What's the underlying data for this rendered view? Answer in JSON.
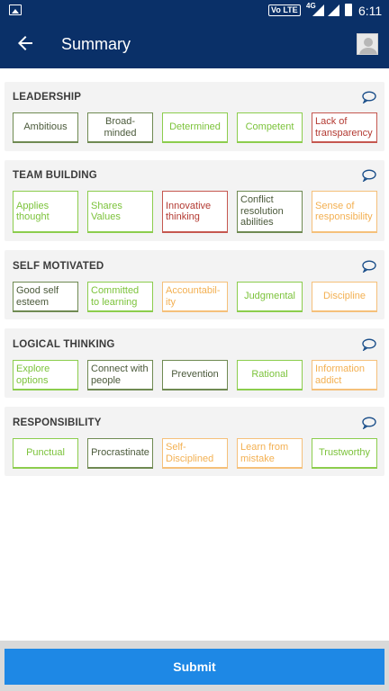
{
  "status_bar": {
    "network_badge": "Vo LTE",
    "network_type": "4G",
    "time": "6:11"
  },
  "header": {
    "title": "Summary"
  },
  "sections": [
    {
      "title": "LEADERSHIP",
      "chips": [
        {
          "label": "Ambitious",
          "color": "dark"
        },
        {
          "label": "Broad-minded",
          "color": "dark"
        },
        {
          "label": "Determined",
          "color": "lime"
        },
        {
          "label": "Competent",
          "color": "lime"
        },
        {
          "label": "Lack of transparency",
          "color": "red"
        }
      ]
    },
    {
      "title": "TEAM BUILDING",
      "chips": [
        {
          "label": "Applies thought",
          "color": "lime"
        },
        {
          "label": "Shares Values",
          "color": "lime"
        },
        {
          "label": "Innovative thinking",
          "color": "red"
        },
        {
          "label": "Conflict resolution abilities",
          "color": "dark"
        },
        {
          "label": "Sense of responsibility",
          "color": "orange"
        }
      ]
    },
    {
      "title": "SELF MOTIVATED",
      "chips": [
        {
          "label": "Good self esteem",
          "color": "dark"
        },
        {
          "label": "Committed to learning",
          "color": "lime"
        },
        {
          "label": "Accountabil-ity",
          "color": "orange"
        },
        {
          "label": "Judgmental",
          "color": "lime"
        },
        {
          "label": "Discipline",
          "color": "orange"
        }
      ]
    },
    {
      "title": "LOGICAL THINKING",
      "chips": [
        {
          "label": "Explore options",
          "color": "lime"
        },
        {
          "label": "Connect with people",
          "color": "dark"
        },
        {
          "label": "Prevention",
          "color": "dark"
        },
        {
          "label": "Rational",
          "color": "lime"
        },
        {
          "label": "Information addict",
          "color": "orange"
        }
      ]
    },
    {
      "title": "RESPONSIBILITY",
      "chips": [
        {
          "label": "Punctual",
          "color": "lime"
        },
        {
          "label": "Procrastinate",
          "color": "dark"
        },
        {
          "label": "Self-Disciplined",
          "color": "orange"
        },
        {
          "label": "Learn from mistake",
          "color": "orange"
        },
        {
          "label": "Trustworthy",
          "color": "lime"
        }
      ]
    }
  ],
  "footer": {
    "submit_label": "Submit"
  },
  "colors": {
    "app_bar": "#0a3068",
    "submit": "#1e88e5",
    "lime": "#7cc33b",
    "dark": "#4b5a3b",
    "orange": "#f3b052",
    "red": "#b33a32"
  }
}
